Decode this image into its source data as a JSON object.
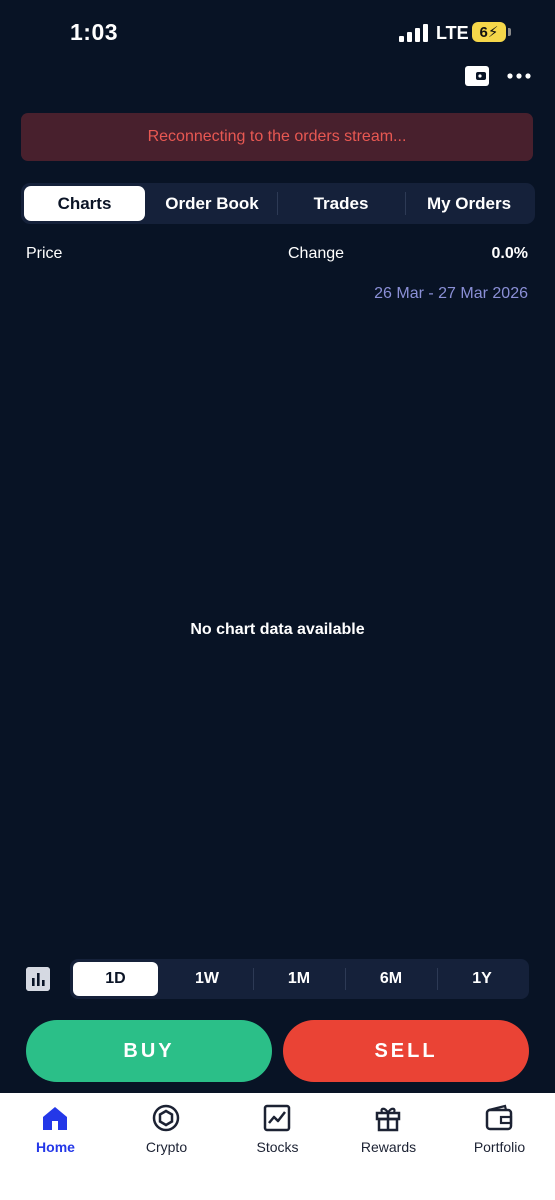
{
  "status_bar": {
    "time": "1:03",
    "network": "LTE",
    "battery": "6"
  },
  "banner": {
    "text": "Reconnecting to the orders stream..."
  },
  "tabs": [
    {
      "label": "Charts",
      "active": true
    },
    {
      "label": "Order Book",
      "active": false
    },
    {
      "label": "Trades",
      "active": false
    },
    {
      "label": "My Orders",
      "active": false
    }
  ],
  "price_row": {
    "price_label": "Price",
    "change_label": "Change",
    "change_value": "0.0%"
  },
  "date_range": "26 Mar - 27 Mar 2026",
  "chart_empty_text": "No chart data available",
  "ranges": [
    {
      "label": "1D",
      "active": true
    },
    {
      "label": "1W",
      "active": false
    },
    {
      "label": "1M",
      "active": false
    },
    {
      "label": "6M",
      "active": false
    },
    {
      "label": "1Y",
      "active": false
    }
  ],
  "actions": {
    "buy_label": "BUY",
    "sell_label": "SELL"
  },
  "nav": [
    {
      "label": "Home",
      "icon": "home-icon",
      "active": true
    },
    {
      "label": "Crypto",
      "icon": "crypto-icon",
      "active": false
    },
    {
      "label": "Stocks",
      "icon": "stocks-icon",
      "active": false
    },
    {
      "label": "Rewards",
      "icon": "gift-icon",
      "active": false
    },
    {
      "label": "Portfolio",
      "icon": "wallet-icon",
      "active": false
    }
  ],
  "colors": {
    "background": "#081325",
    "banner_bg": "#48202d",
    "banner_text": "#e85852",
    "buy": "#2bbf88",
    "sell": "#ea4335",
    "nav_active": "#2438e8"
  }
}
